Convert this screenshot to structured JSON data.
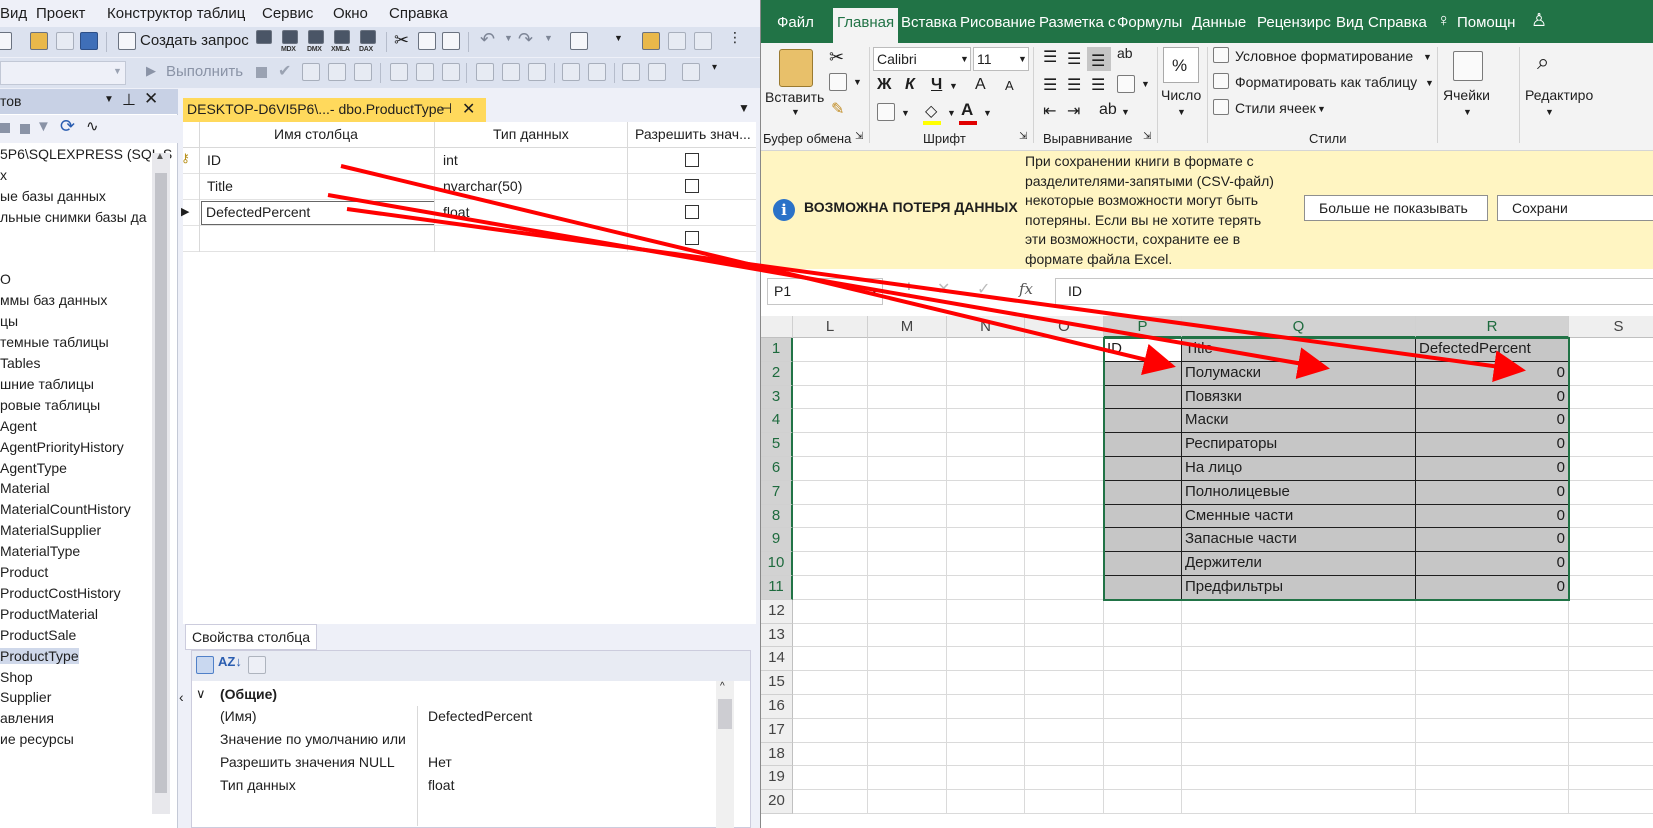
{
  "ssms": {
    "menu": [
      "Вид",
      "Проект",
      "Конструктор таблиц",
      "Сервис",
      "Окно",
      "Справка"
    ],
    "toolbar": {
      "new_query": "Создать запрос",
      "execute": "Выполнить",
      "icon_labels": [
        "MDX",
        "DMX",
        "XMLA",
        "DAX"
      ]
    },
    "object_explorer": {
      "title": "тов",
      "items": [
        {
          "label": "5P6\\SQLEXPRESS (SQL S",
          "selected": false
        },
        {
          "label": "х",
          "selected": false
        },
        {
          "label": "ые базы данных",
          "selected": false
        },
        {
          "label": "льные снимки базы да",
          "selected": false
        },
        {
          "label": "",
          "selected": false
        },
        {
          "label": "",
          "selected": false
        },
        {
          "label": "O",
          "selected": false
        },
        {
          "label": "ммы баз данных",
          "selected": false
        },
        {
          "label": "цы",
          "selected": false
        },
        {
          "label": "темные таблицы",
          "selected": false
        },
        {
          "label": "Tables",
          "selected": false
        },
        {
          "label": "шние таблицы",
          "selected": false
        },
        {
          "label": "ровые таблицы",
          "selected": false
        },
        {
          "label": "Agent",
          "selected": false
        },
        {
          "label": "AgentPriorityHistory",
          "selected": false
        },
        {
          "label": "AgentType",
          "selected": false
        },
        {
          "label": "Material",
          "selected": false
        },
        {
          "label": "MaterialCountHistory",
          "selected": false
        },
        {
          "label": "MaterialSupplier",
          "selected": false
        },
        {
          "label": "MaterialType",
          "selected": false
        },
        {
          "label": "Product",
          "selected": false
        },
        {
          "label": "ProductCostHistory",
          "selected": false
        },
        {
          "label": "ProductMaterial",
          "selected": false
        },
        {
          "label": "ProductSale",
          "selected": false
        },
        {
          "label": "ProductType",
          "selected": true
        },
        {
          "label": "Shop",
          "selected": false
        },
        {
          "label": "Supplier",
          "selected": false
        },
        {
          "label": "авления",
          "selected": false
        },
        {
          "label": "ие ресурсы",
          "selected": false
        }
      ]
    },
    "designer": {
      "tab_title": "DESKTOP-D6VI5P6\\...- dbo.ProductType",
      "headers": {
        "name": "Имя столбца",
        "type": "Тип данных",
        "nulls": "Разрешить знач..."
      },
      "rows": [
        {
          "name": "ID",
          "type": "int",
          "key": true,
          "current": false
        },
        {
          "name": "Title",
          "type": "nvarchar(50)",
          "key": false,
          "current": false
        },
        {
          "name": "DefectedPercent",
          "type": "float",
          "key": false,
          "current": true
        },
        {
          "name": "",
          "type": "",
          "key": false,
          "current": false
        }
      ]
    },
    "properties": {
      "tab": "Свойства столбца",
      "group": "(Общие)",
      "rows": [
        {
          "name": "(Имя)",
          "value": "DefectedPercent"
        },
        {
          "name": "Значение по умолчанию или",
          "value": ""
        },
        {
          "name": "Разрешить значения NULL",
          "value": "Нет"
        },
        {
          "name": "Тип данных",
          "value": "float"
        }
      ]
    }
  },
  "excel": {
    "tabs": [
      "Файл",
      "Главная",
      "Вставка",
      "Рисование",
      "Разметка с",
      "Формулы",
      "Данные",
      "Рецензирс",
      "Вид",
      "Справка",
      "Помощн"
    ],
    "active_tab": "Главная",
    "ribbon": {
      "paste": "Вставить",
      "clipboard": "Буфер обмена",
      "font_name": "Calibri",
      "font_size": "11",
      "font_group": "Шрифт",
      "align_group": "Выравнивание",
      "number_label": "Число",
      "percent": "%",
      "cond_format": "Условное форматирование",
      "format_table": "Форматировать как таблицу",
      "cell_styles": "Стили ячеек",
      "styles_group": "Стили",
      "cells": "Ячейки",
      "editing": "Редактиро"
    },
    "message": {
      "title": "ВОЗМОЖНА ПОТЕРЯ ДАННЫХ",
      "lines": [
        "При сохранении книги в формате с",
        "разделителями-запятыми (CSV-файл)",
        "некоторые возможности могут быть",
        "потеряны. Если вы не хотите терять",
        "эти возможности, сохраните ее в",
        "формате файла Excel."
      ],
      "btn_dont_show": "Больше не показывать",
      "btn_save": "Сохрани"
    },
    "name_box": "P1",
    "fx": "fx",
    "formula_value": "ID",
    "columns": [
      "L",
      "M",
      "N",
      "O",
      "P",
      "Q",
      "R",
      "S"
    ],
    "selected_columns": [
      "P",
      "Q",
      "R"
    ],
    "rows": [
      {
        "n": "1",
        "p": "ID",
        "q": "Title",
        "r": "DefectedPercent"
      },
      {
        "n": "2",
        "p": "",
        "q": "Полумаски",
        "r": "0"
      },
      {
        "n": "3",
        "p": "",
        "q": "Повязки",
        "r": "0"
      },
      {
        "n": "4",
        "p": "",
        "q": "Маски",
        "r": "0"
      },
      {
        "n": "5",
        "p": "",
        "q": "Респираторы",
        "r": "0"
      },
      {
        "n": "6",
        "p": "",
        "q": "На лицо",
        "r": "0"
      },
      {
        "n": "7",
        "p": "",
        "q": "Полнолицевые",
        "r": "0"
      },
      {
        "n": "8",
        "p": "",
        "q": "Сменные части",
        "r": "0"
      },
      {
        "n": "9",
        "p": "",
        "q": "Запасные части",
        "r": "0"
      },
      {
        "n": "10",
        "p": "",
        "q": "Держители",
        "r": "0"
      },
      {
        "n": "11",
        "p": "",
        "q": "Предфильтры",
        "r": "0"
      },
      {
        "n": "12",
        "p": "",
        "q": "",
        "r": ""
      },
      {
        "n": "13",
        "p": "",
        "q": "",
        "r": ""
      },
      {
        "n": "14",
        "p": "",
        "q": "",
        "r": ""
      },
      {
        "n": "15",
        "p": "",
        "q": "",
        "r": ""
      },
      {
        "n": "16",
        "p": "",
        "q": "",
        "r": ""
      },
      {
        "n": "17",
        "p": "",
        "q": "",
        "r": ""
      },
      {
        "n": "18",
        "p": "",
        "q": "",
        "r": ""
      },
      {
        "n": "19",
        "p": "",
        "q": "",
        "r": ""
      },
      {
        "n": "20",
        "p": "",
        "q": "",
        "r": ""
      }
    ]
  },
  "colors": {
    "excel_green": "#217346",
    "annotation_arrow": "#ff0000",
    "tab_yellow": "#ffd95c",
    "message_bg": "#fff5c2"
  }
}
